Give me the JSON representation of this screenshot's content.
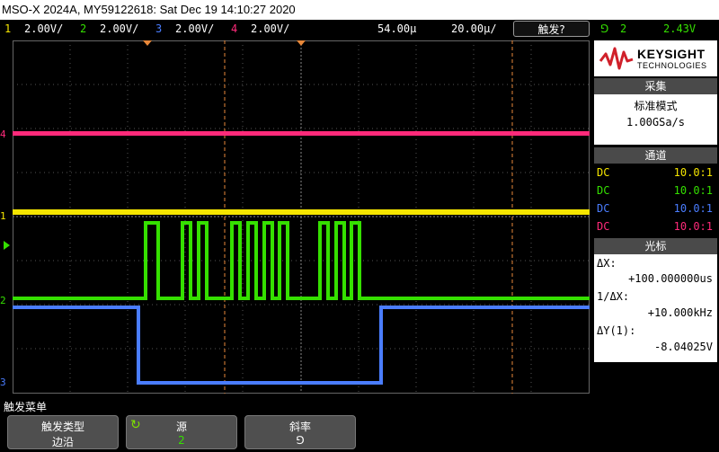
{
  "title": "MSO-X 2024A, MY59122618: Sat Dec 19 14:10:27 2020",
  "status": {
    "ch1": {
      "num": "1",
      "scale": "2.00V/",
      "color": "#f5e500"
    },
    "ch2": {
      "num": "2",
      "scale": "2.00V/",
      "color": "#35e000"
    },
    "ch3": {
      "num": "3",
      "scale": "2.00V/",
      "color": "#4a7dff"
    },
    "ch4": {
      "num": "4",
      "scale": "2.00V/",
      "color": "#ff2a7a"
    },
    "delay": "54.00µ",
    "timebase": "20.00µ/",
    "trigger_button": "触发?",
    "trig_source": "2",
    "trig_level": "2.43V"
  },
  "logo": {
    "name": "KEYSIGHT",
    "sub": "TECHNOLOGIES"
  },
  "acquire": {
    "header": "采集",
    "mode": "标准模式",
    "rate": "1.00GSa/s"
  },
  "channels": {
    "header": "通道",
    "rows": [
      {
        "coupling": "DC",
        "probe": "10.0:1",
        "color": "#f5e500"
      },
      {
        "coupling": "DC",
        "probe": "10.0:1",
        "color": "#35e000"
      },
      {
        "coupling": "DC",
        "probe": "10.0:1",
        "color": "#4a7dff"
      },
      {
        "coupling": "DC",
        "probe": "10.0:1",
        "color": "#ff2a7a"
      }
    ]
  },
  "cursors": {
    "header": "光标",
    "dx_label": "ΔX:",
    "dx_value": "+100.000000us",
    "inv_dx_label": "1/ΔX:",
    "inv_dx_value": "+10.000kHz",
    "dy_label": "ΔY(1):",
    "dy_value": "-8.04025V"
  },
  "menu": {
    "label": "触发菜单",
    "keys": [
      {
        "title": "触发类型",
        "value": "边沿"
      },
      {
        "title": "源",
        "value": "2"
      },
      {
        "title": "斜率",
        "value": "⅁"
      }
    ]
  },
  "markers": {
    "ch4": "4",
    "ch1": "1",
    "ch2": "2",
    "ch3": "3"
  }
}
